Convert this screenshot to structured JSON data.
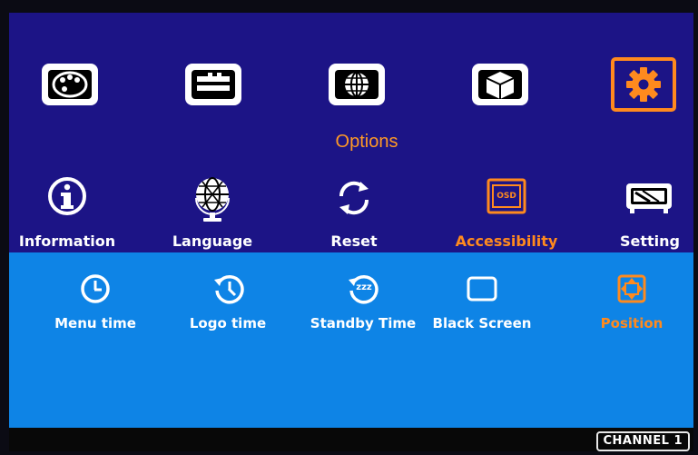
{
  "tabs": [
    {
      "icon": "palette-icon"
    },
    {
      "icon": "input-source-icon"
    },
    {
      "icon": "globe-window-icon"
    },
    {
      "icon": "3d-cube-icon"
    },
    {
      "icon": "gear-icon",
      "selected": true
    }
  ],
  "page_title": "Options",
  "options_menu": [
    {
      "label": "Information",
      "icon": "info-icon"
    },
    {
      "label": "Language",
      "icon": "globe-icon"
    },
    {
      "label": "Reset",
      "icon": "refresh-icon"
    },
    {
      "label": "Accessibility",
      "icon": "osd-icon",
      "selected": true,
      "icon_text": "OSD"
    },
    {
      "label": "Setting",
      "icon": "device-setting-icon"
    }
  ],
  "submenu": [
    {
      "label": "Menu time",
      "icon": "clock-icon"
    },
    {
      "label": "Logo time",
      "icon": "history-clock-icon"
    },
    {
      "label": "Standby Time",
      "icon": "sleep-timer-icon",
      "icon_text": "zzz"
    },
    {
      "label": "Black Screen",
      "icon": "blank-screen-icon"
    },
    {
      "label": "Position",
      "icon": "position-move-icon"
    }
  ],
  "status": {
    "channel": "CHANNEL 1"
  },
  "colors": {
    "top_panel": "#1c1486",
    "bottom_panel": "#0e84e6",
    "accent": "#ff8a1e",
    "status_bar": "#080808"
  }
}
